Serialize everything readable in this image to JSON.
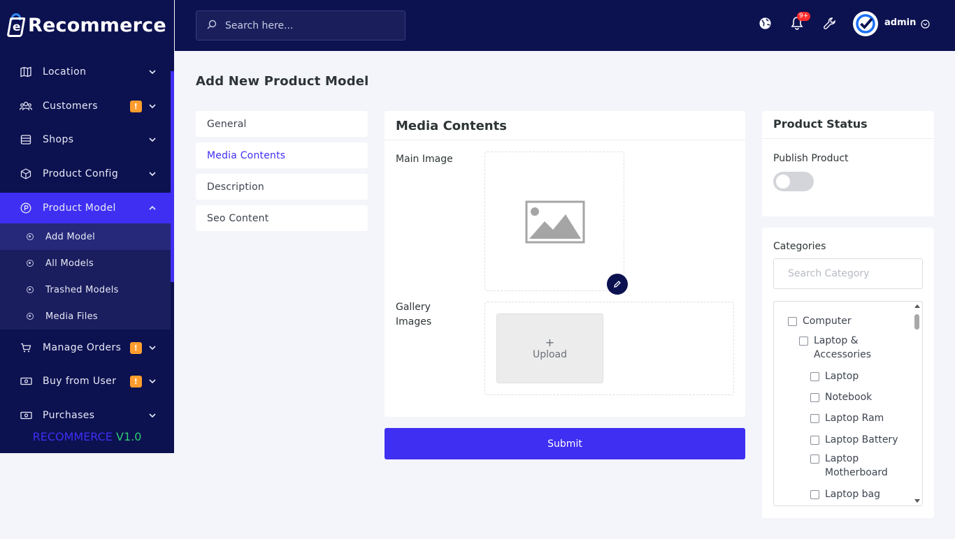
{
  "brand": {
    "name": "Recommerce"
  },
  "search": {
    "placeholder": "Search here..."
  },
  "user": {
    "name": "admin",
    "notifications": "9+"
  },
  "sidebar": {
    "items": [
      {
        "label": "Location",
        "icon": "map-icon"
      },
      {
        "label": "Customers",
        "icon": "users-icon",
        "badge": "!"
      },
      {
        "label": "Shops",
        "icon": "store-icon"
      },
      {
        "label": "Product Config",
        "icon": "settings-cube-icon"
      },
      {
        "label": "Product Model",
        "icon": "product-circle-icon"
      },
      {
        "label": "Manage Orders",
        "icon": "cart-icon",
        "badge": "!"
      },
      {
        "label": "Buy from User",
        "icon": "money-icon",
        "badge": "!"
      },
      {
        "label": "Purchases",
        "icon": "money-icon"
      }
    ],
    "submenu": [
      {
        "label": "Add Model"
      },
      {
        "label": "All Models"
      },
      {
        "label": "Trashed Models"
      },
      {
        "label": "Media Files"
      }
    ],
    "version_brand": "RECOMMERCE",
    "version_number": "V1.0"
  },
  "page": {
    "title": "Add New Product Model"
  },
  "tabs": [
    {
      "label": "General"
    },
    {
      "label": "Media Contents"
    },
    {
      "label": "Description"
    },
    {
      "label": "Seo Content"
    }
  ],
  "media": {
    "title": "Media Contents",
    "main_image_label": "Main Image",
    "gallery_label": "Gallery Images",
    "upload_plus": "+",
    "upload_label": "Upload"
  },
  "submit_label": "Submit",
  "status": {
    "title": "Product Status",
    "publish_label": "Publish Product",
    "published": false
  },
  "categories": {
    "title": "Categories",
    "search_placeholder": "Search Category",
    "items": [
      {
        "label": "Computer"
      },
      {
        "label": "Laptop & Accessories"
      },
      {
        "label": "Laptop"
      },
      {
        "label": "Notebook"
      },
      {
        "label": "Laptop Ram"
      },
      {
        "label": "Laptop Battery"
      },
      {
        "label": "Laptop Motherboard"
      },
      {
        "label": "Laptop bag"
      }
    ]
  },
  "colors": {
    "accent": "#3f2ff2",
    "sidebar": "#0c1150",
    "badge": "#ff9d2e",
    "version_green": "#2ecc71"
  }
}
